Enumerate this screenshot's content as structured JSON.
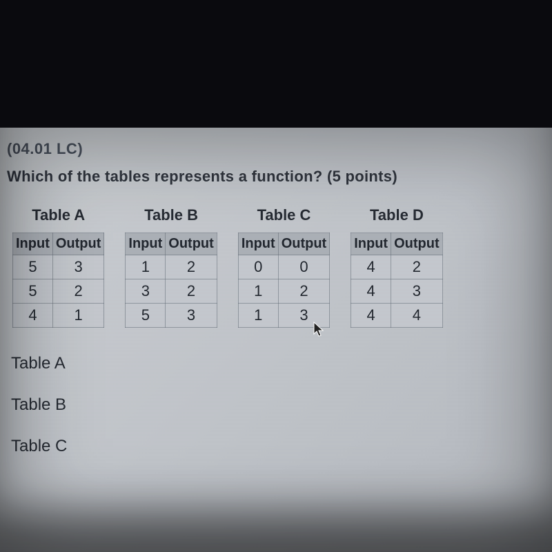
{
  "question": {
    "code": "(04.01 LC)",
    "text": "Which of the tables represents a function? (5 points)"
  },
  "tables": [
    {
      "title": "Table A",
      "headers": [
        "Input",
        "Output"
      ],
      "rows": [
        [
          "5",
          "3"
        ],
        [
          "5",
          "2"
        ],
        [
          "4",
          "1"
        ]
      ]
    },
    {
      "title": "Table B",
      "headers": [
        "Input",
        "Output"
      ],
      "rows": [
        [
          "1",
          "2"
        ],
        [
          "3",
          "2"
        ],
        [
          "5",
          "3"
        ]
      ]
    },
    {
      "title": "Table C",
      "headers": [
        "Input",
        "Output"
      ],
      "rows": [
        [
          "0",
          "0"
        ],
        [
          "1",
          "2"
        ],
        [
          "1",
          "3"
        ]
      ]
    },
    {
      "title": "Table D",
      "headers": [
        "Input",
        "Output"
      ],
      "rows": [
        [
          "4",
          "2"
        ],
        [
          "4",
          "3"
        ],
        [
          "4",
          "4"
        ]
      ]
    }
  ],
  "options": [
    "Table A",
    "Table B",
    "Table C"
  ]
}
